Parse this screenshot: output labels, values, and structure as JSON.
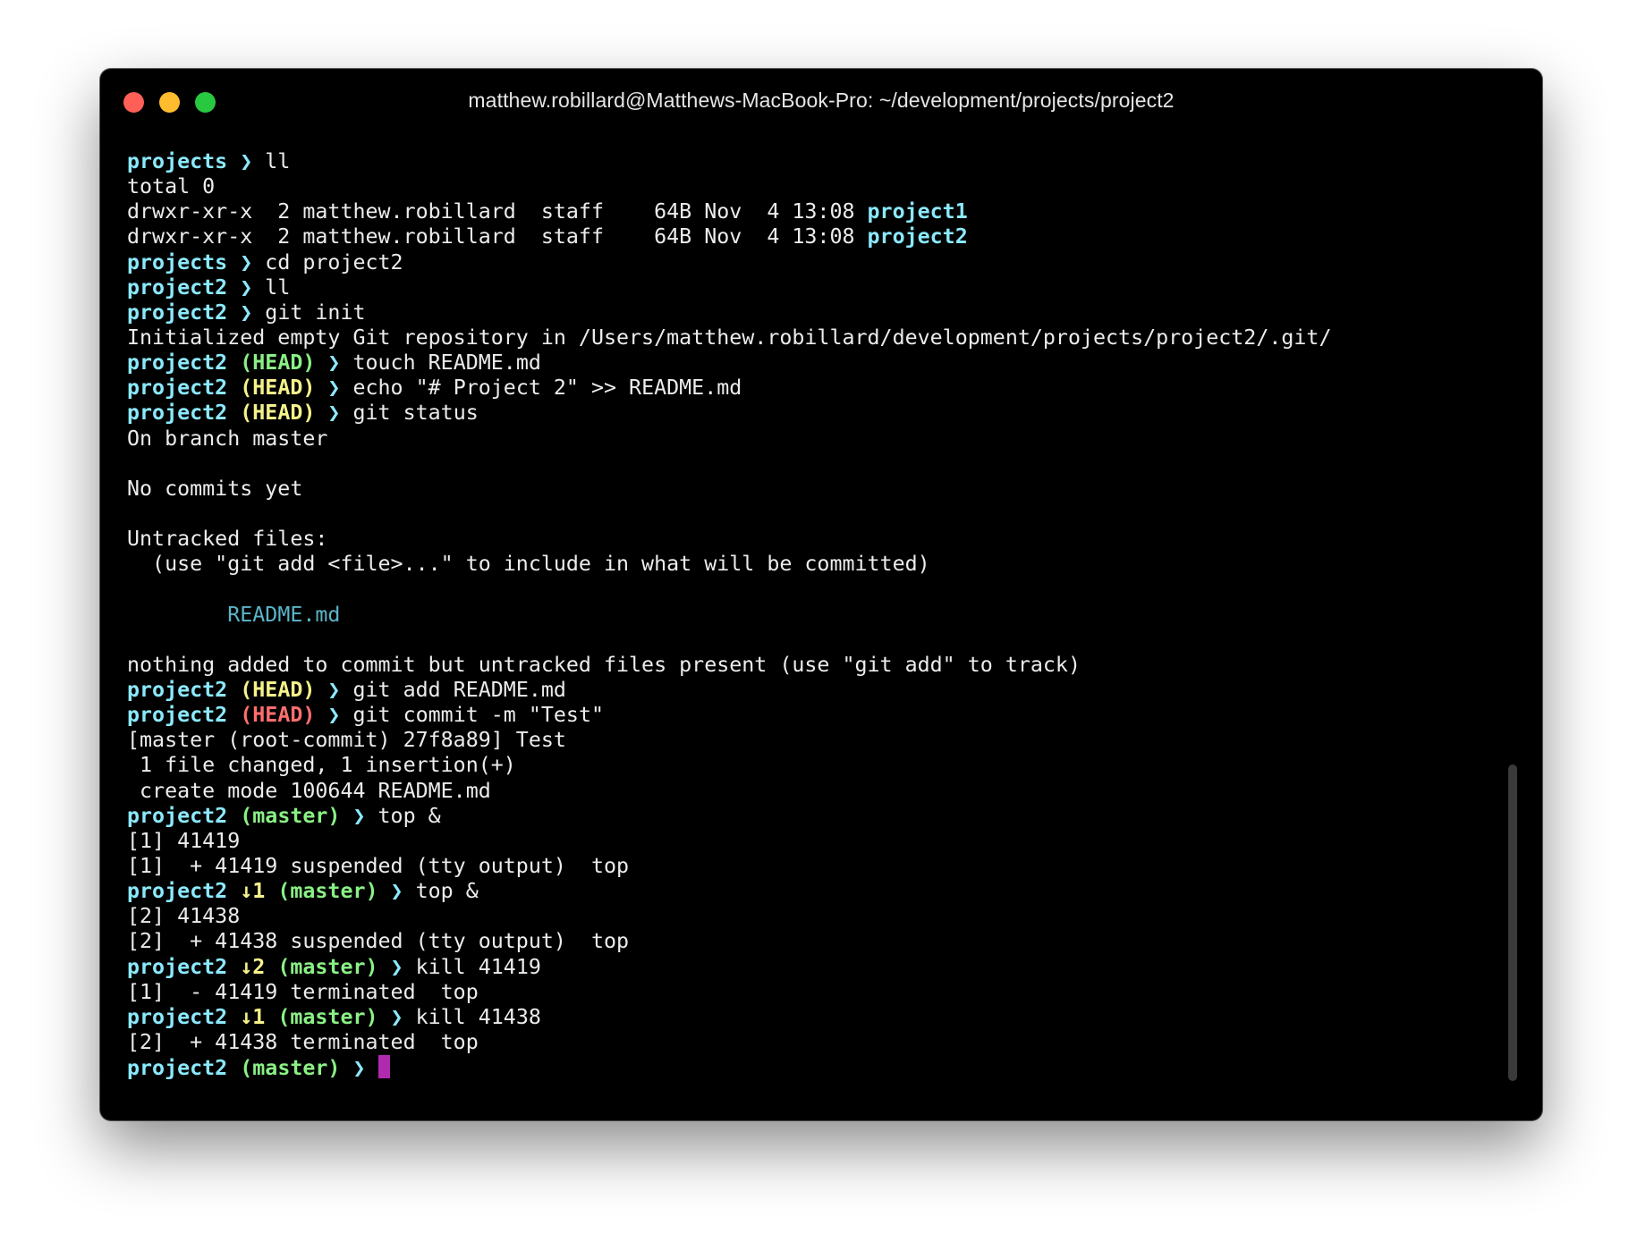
{
  "window": {
    "title": "matthew.robillard@Matthews-MacBook-Pro: ~/development/projects/project2",
    "buttons": [
      {
        "name": "close-button",
        "color": "#fe5f57"
      },
      {
        "name": "minimize-button",
        "color": "#febc2e"
      },
      {
        "name": "zoom-button",
        "color": "#28c840"
      }
    ]
  },
  "colors": {
    "cyan": "#8be9fd",
    "green": "#8af085",
    "yellow": "#f5f28a",
    "red": "#ff6e6e",
    "file": "#5ab5c8",
    "text": "#ececec",
    "cursor": "#b02ab0"
  },
  "terminal": {
    "lines": [
      [
        {
          "t": "projects",
          "c": "cyan",
          "b": true
        },
        {
          "t": " ❯ ",
          "c": "cyan",
          "b": true
        },
        {
          "t": "ll"
        }
      ],
      [
        {
          "t": "total 0"
        }
      ],
      [
        {
          "t": "drwxr-xr-x  2 matthew.robillard  staff    64B Nov  4 13:08 "
        },
        {
          "t": "project1",
          "c": "cyan",
          "b": true
        }
      ],
      [
        {
          "t": "drwxr-xr-x  2 matthew.robillard  staff    64B Nov  4 13:08 "
        },
        {
          "t": "project2",
          "c": "cyan",
          "b": true
        }
      ],
      [
        {
          "t": "projects",
          "c": "cyan",
          "b": true
        },
        {
          "t": " ❯ ",
          "c": "cyan",
          "b": true
        },
        {
          "t": "cd project2"
        }
      ],
      [
        {
          "t": "project2",
          "c": "cyan",
          "b": true
        },
        {
          "t": " ❯ ",
          "c": "cyan",
          "b": true
        },
        {
          "t": "ll"
        }
      ],
      [
        {
          "t": "project2",
          "c": "cyan",
          "b": true
        },
        {
          "t": " ❯ ",
          "c": "cyan",
          "b": true
        },
        {
          "t": "git init"
        }
      ],
      [
        {
          "t": "Initialized empty Git repository in /Users/matthew.robillard/development/projects/project2/.git/"
        }
      ],
      [
        {
          "t": "project2",
          "c": "cyan",
          "b": true
        },
        {
          "t": " (HEAD)",
          "c": "green",
          "b": true
        },
        {
          "t": " ❯ ",
          "c": "cyan",
          "b": true
        },
        {
          "t": "touch README.md"
        }
      ],
      [
        {
          "t": "project2",
          "c": "cyan",
          "b": true
        },
        {
          "t": " (HEAD)",
          "c": "yellow",
          "b": true
        },
        {
          "t": " ❯ ",
          "c": "cyan",
          "b": true
        },
        {
          "t": "echo \"# Project 2\" >> README.md"
        }
      ],
      [
        {
          "t": "project2",
          "c": "cyan",
          "b": true
        },
        {
          "t": " (HEAD)",
          "c": "yellow",
          "b": true
        },
        {
          "t": " ❯ ",
          "c": "cyan",
          "b": true
        },
        {
          "t": "git status"
        }
      ],
      [
        {
          "t": "On branch master"
        }
      ],
      [
        {
          "t": ""
        }
      ],
      [
        {
          "t": "No commits yet"
        }
      ],
      [
        {
          "t": ""
        }
      ],
      [
        {
          "t": "Untracked files:"
        }
      ],
      [
        {
          "t": "  (use \"git add <file>...\" to include in what will be committed)"
        }
      ],
      [
        {
          "t": ""
        }
      ],
      [
        {
          "t": "        "
        },
        {
          "t": "README.md",
          "c": "file"
        }
      ],
      [
        {
          "t": ""
        }
      ],
      [
        {
          "t": "nothing added to commit but untracked files present (use \"git add\" to track)"
        }
      ],
      [
        {
          "t": "project2",
          "c": "cyan",
          "b": true
        },
        {
          "t": " (HEAD)",
          "c": "yellow",
          "b": true
        },
        {
          "t": " ❯ ",
          "c": "cyan",
          "b": true
        },
        {
          "t": "git add README.md"
        }
      ],
      [
        {
          "t": "project2",
          "c": "cyan",
          "b": true
        },
        {
          "t": " (HEAD)",
          "c": "red",
          "b": true
        },
        {
          "t": " ❯ ",
          "c": "cyan",
          "b": true
        },
        {
          "t": "git commit -m \"Test\""
        }
      ],
      [
        {
          "t": "[master (root-commit) 27f8a89] Test"
        }
      ],
      [
        {
          "t": " 1 file changed, 1 insertion(+)"
        }
      ],
      [
        {
          "t": " create mode 100644 README.md"
        }
      ],
      [
        {
          "t": "project2",
          "c": "cyan",
          "b": true
        },
        {
          "t": " (master)",
          "c": "green",
          "b": true
        },
        {
          "t": " ❯ ",
          "c": "cyan",
          "b": true
        },
        {
          "t": "top &"
        }
      ],
      [
        {
          "t": "[1] 41419"
        }
      ],
      [
        {
          "t": "[1]  + 41419 suspended (tty output)  top"
        }
      ],
      [
        {
          "t": "project2",
          "c": "cyan",
          "b": true
        },
        {
          "t": " ↓1",
          "c": "yellow",
          "b": true
        },
        {
          "t": " (master)",
          "c": "green",
          "b": true
        },
        {
          "t": " ❯ ",
          "c": "cyan",
          "b": true
        },
        {
          "t": "top &"
        }
      ],
      [
        {
          "t": "[2] 41438"
        }
      ],
      [
        {
          "t": "[2]  + 41438 suspended (tty output)  top"
        }
      ],
      [
        {
          "t": "project2",
          "c": "cyan",
          "b": true
        },
        {
          "t": " ↓2",
          "c": "yellow",
          "b": true
        },
        {
          "t": " (master)",
          "c": "green",
          "b": true
        },
        {
          "t": " ❯ ",
          "c": "cyan",
          "b": true
        },
        {
          "t": "kill 41419"
        }
      ],
      [
        {
          "t": "[1]  - 41419 terminated  top"
        }
      ],
      [
        {
          "t": "project2",
          "c": "cyan",
          "b": true
        },
        {
          "t": " ↓1",
          "c": "yellow",
          "b": true
        },
        {
          "t": " (master)",
          "c": "green",
          "b": true
        },
        {
          "t": " ❯ ",
          "c": "cyan",
          "b": true
        },
        {
          "t": "kill 41438"
        }
      ],
      [
        {
          "t": "[2]  + 41438 terminated  top"
        }
      ],
      [
        {
          "t": "project2",
          "c": "cyan",
          "b": true
        },
        {
          "t": " (master)",
          "c": "green",
          "b": true
        },
        {
          "t": " ❯ ",
          "c": "cyan",
          "b": true
        },
        {
          "cursor": true
        }
      ]
    ]
  }
}
